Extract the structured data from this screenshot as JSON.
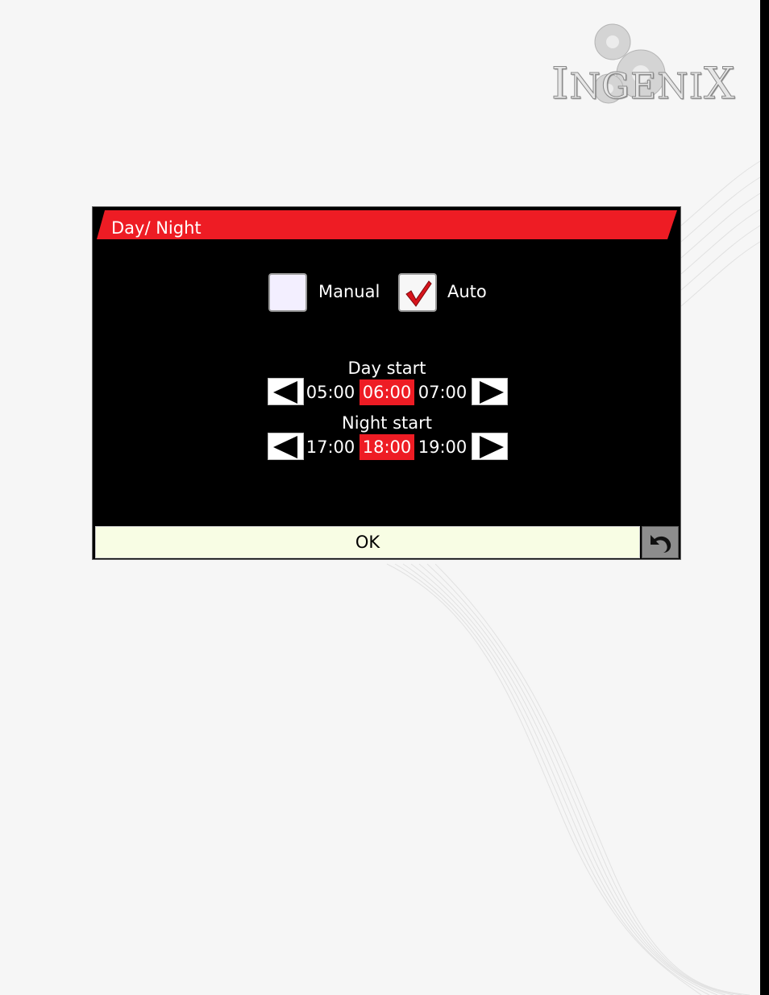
{
  "brand": {
    "logo_text_initial": "I",
    "logo_text_rest": "NGENI",
    "logo_text_end": "X"
  },
  "dialog": {
    "title": "Day/ Night",
    "mode": {
      "manual_label": "Manual",
      "manual_checked": false,
      "auto_label": "Auto",
      "auto_checked": true
    },
    "day_start": {
      "label": "Day start",
      "prev": "05:00",
      "current": "06:00",
      "next": "07:00"
    },
    "night_start": {
      "label": "Night start",
      "prev": "17:00",
      "current": "18:00",
      "next": "19:00"
    },
    "ok_label": "OK"
  },
  "colors": {
    "accent": "#ee1c24",
    "dialog_bg": "#000000",
    "ok_bg": "#f8fde4"
  },
  "icons": [
    "gear-icon",
    "checkmark-icon",
    "arrow-left-icon",
    "arrow-right-icon",
    "undo-icon"
  ]
}
